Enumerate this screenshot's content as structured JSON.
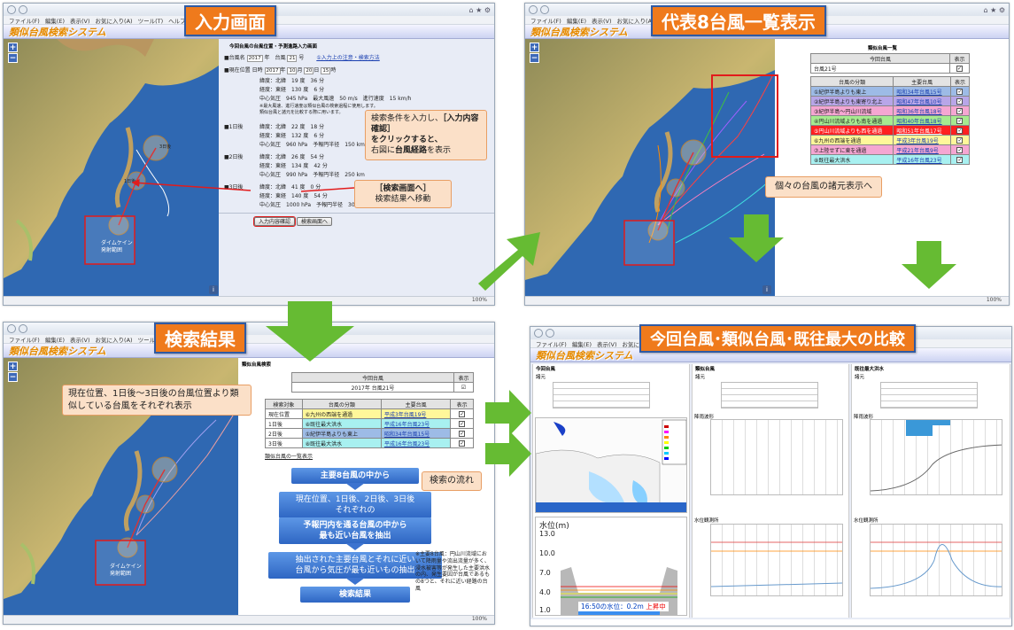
{
  "common": {
    "app_title": "類似台風検索システム",
    "menu": [
      "ファイル(F)",
      "編集(E)",
      "表示(V)",
      "お気に入り(A)",
      "ツール(T)",
      "ヘルプ(H)"
    ],
    "zoom_plus": "+",
    "zoom_minus": "−",
    "info": "i",
    "zoom_status": "100%"
  },
  "panel_input": {
    "banner": "入力画面",
    "form_title": "今回台風の台風位置・予測進路入力画面",
    "row_name": {
      "label": "■台風名",
      "year": "2017",
      "year_unit": "年　台風",
      "number": "21",
      "number_unit": "号",
      "help": "①入力上の注意・検索方法"
    },
    "row_current": {
      "label": "■現在位置",
      "date_label": "日時",
      "year": "2017",
      "m": "10",
      "d": "20",
      "h": "15",
      "unit_year": "年",
      "unit_month": "月",
      "unit_day": "日",
      "unit_hour": "時"
    },
    "lat1": "緯度：北緯　19 度　36 分",
    "lon1": "経度：東経　130 度　6 分",
    "press1": "中心気圧　945 hPa　最大風速　50 m/s　進行速度　15 km/h",
    "note1": "※最大風速、進行速度は類似台風の検索過程に使用します。",
    "note2": "類似台風と諸元を比較する際に用います。",
    "d1_label": "■1日後",
    "d1_lat": "緯度：北緯　22 度　18 分",
    "d1_lon": "経度：東経　132 度　6 分",
    "d1_press": "中心気圧　960 hPa　予報円半径　150 km",
    "d2_label": "■2日後",
    "d2_lat": "緯度：北緯　26 度　54 分",
    "d2_lon": "経度：東経　134 度　42 分",
    "d2_press": "中心気圧　990 hPa　予報円半径　250 km",
    "d3_label": "■3日後",
    "d3_lat": "緯度：北緯　41 度　0 分",
    "d3_lon": "経度：東経　140 度　54 分",
    "d3_press": "中心気圧　1000 hPa　予報円半径　300 km",
    "confirm_button": "入力内容確認",
    "search_button": "検索画面へ",
    "callout_top_1": "検索条件を入力し、",
    "callout_top_2": "［入力内容確認］",
    "callout_top_3": "をクリックすると、",
    "callout_top_4": "右図に",
    "callout_top_5": "台風経路",
    "callout_top_6": "を表示",
    "callout_bottom_1": "［検索画面へ］",
    "callout_bottom_2": "検索結果へ移動",
    "map_label_1": "ダイムケイン",
    "map_label_2": "発射範囲",
    "map_label_3": "1日後",
    "map_label_4": "3日後"
  },
  "panel_result": {
    "banner": "検索結果",
    "header": "類似台風検索",
    "table_top": {
      "h1": "今回台風",
      "h2": "表示",
      "v1": "2017年 台風21号",
      "v2": "☑"
    },
    "table_cols": [
      "検索対象",
      "台風の分類",
      "主要台風",
      "表示"
    ],
    "rows": [
      {
        "target": "現在位置",
        "class": "⑥九州の西端を通過",
        "main": "平成3年台風19号",
        "color": "#fff79a"
      },
      {
        "target": "1日後",
        "class": "⑧既往最大洪水",
        "main": "平成16年台風23号",
        "color": "#a8f0f0"
      },
      {
        "target": "2日後",
        "class": "①紀伊半島よりも東上",
        "main": "昭和34年台風15号",
        "color": "#9dbbe6"
      },
      {
        "target": "3日後",
        "class": "⑧既往最大洪水",
        "main": "平成16年台風23号",
        "color": "#a8f0f0"
      }
    ],
    "list_link": "類似台風の一覧表示",
    "callout": "現在位置、1日後～3日後の台風位置より類似している台風をそれぞれ表示",
    "flow_label": "検索の流れ",
    "flow1": "主要8台風の中から",
    "flow2a": "現在位置、1日後、2日後、3日後",
    "flow2b": "それぞれの",
    "flow3a": "予報円内を通る台風の中から",
    "flow3b": "最も近い台風を抽出",
    "flow4a": "抽出された主要台風とそれに近い",
    "flow4b": "台風から気圧が最も近いもの抽出",
    "flow5": "検索結果",
    "footnote": "※主要8台風：円山川流域において降雨量や流出流量が多く、浸水被害等が発生した主要洪水の内、発生要因が台風であるもの8つと、それに近い経路の台風",
    "map_label_1": "ダイムケイン",
    "map_label_2": "発射範囲"
  },
  "panel_list": {
    "banner": "代表8台風一覧表示",
    "header": "類似台風一覧",
    "top_h1": "今回台風",
    "top_h2": "表示",
    "top_v1": "台風21号",
    "cols": [
      "台風の分類",
      "主要台風",
      "表示"
    ],
    "rows": [
      {
        "class": "①紀伊半島よりも東上",
        "main": "昭和34年台風15号",
        "color": "#9dbbe6"
      },
      {
        "class": "②紀伊半島よりも東寄り北上",
        "main": "昭和47年台風10号",
        "color": "#b8a6e8"
      },
      {
        "class": "③紀伊半島～円山川流域",
        "main": "昭和36年台風18号",
        "color": "#f5a6d2"
      },
      {
        "class": "④円山川流域よりも南を通過",
        "main": "昭和40年台風18号",
        "color": "#a6ea8f"
      },
      {
        "class": "⑤円山川流域よりも西を通過",
        "main": "昭和51年台風17号",
        "color": "#ff2020"
      },
      {
        "class": "⑥九州の西端を通過",
        "main": "平成3年台風19号",
        "color": "#fff79a"
      },
      {
        "class": "⑦上陸せずに東を通過",
        "main": "平成21年台風9号",
        "color": "#f5a6d2"
      },
      {
        "class": "⑧既往最大洪水",
        "main": "平成16年台風23号",
        "color": "#a8f0f0"
      }
    ],
    "callout": "個々の台風の諸元表示へ"
  },
  "panel_compare": {
    "banner": "今回台風･類似台風･既往最大の比較",
    "col1_title": "今回台風",
    "col2_title": "類似台風",
    "col3_title": "既往最大洪水",
    "col_sub": "諸元",
    "water_title": "水位(m)",
    "water_axis": [
      "13.0",
      "10.0",
      "7.0",
      "4.0",
      "1.0"
    ],
    "water_readout": "16:50の水位：0.2m",
    "water_trend": "上昇中",
    "chart_hdr_rain": "降雨波形",
    "chart_hdr_level": "水位観測所"
  },
  "colors": {
    "arrow_green": "#66bb33",
    "banner_orange": "#ef7a1c",
    "banner_border": "#2f5aa3",
    "highlight_red": "#e21b1b"
  }
}
